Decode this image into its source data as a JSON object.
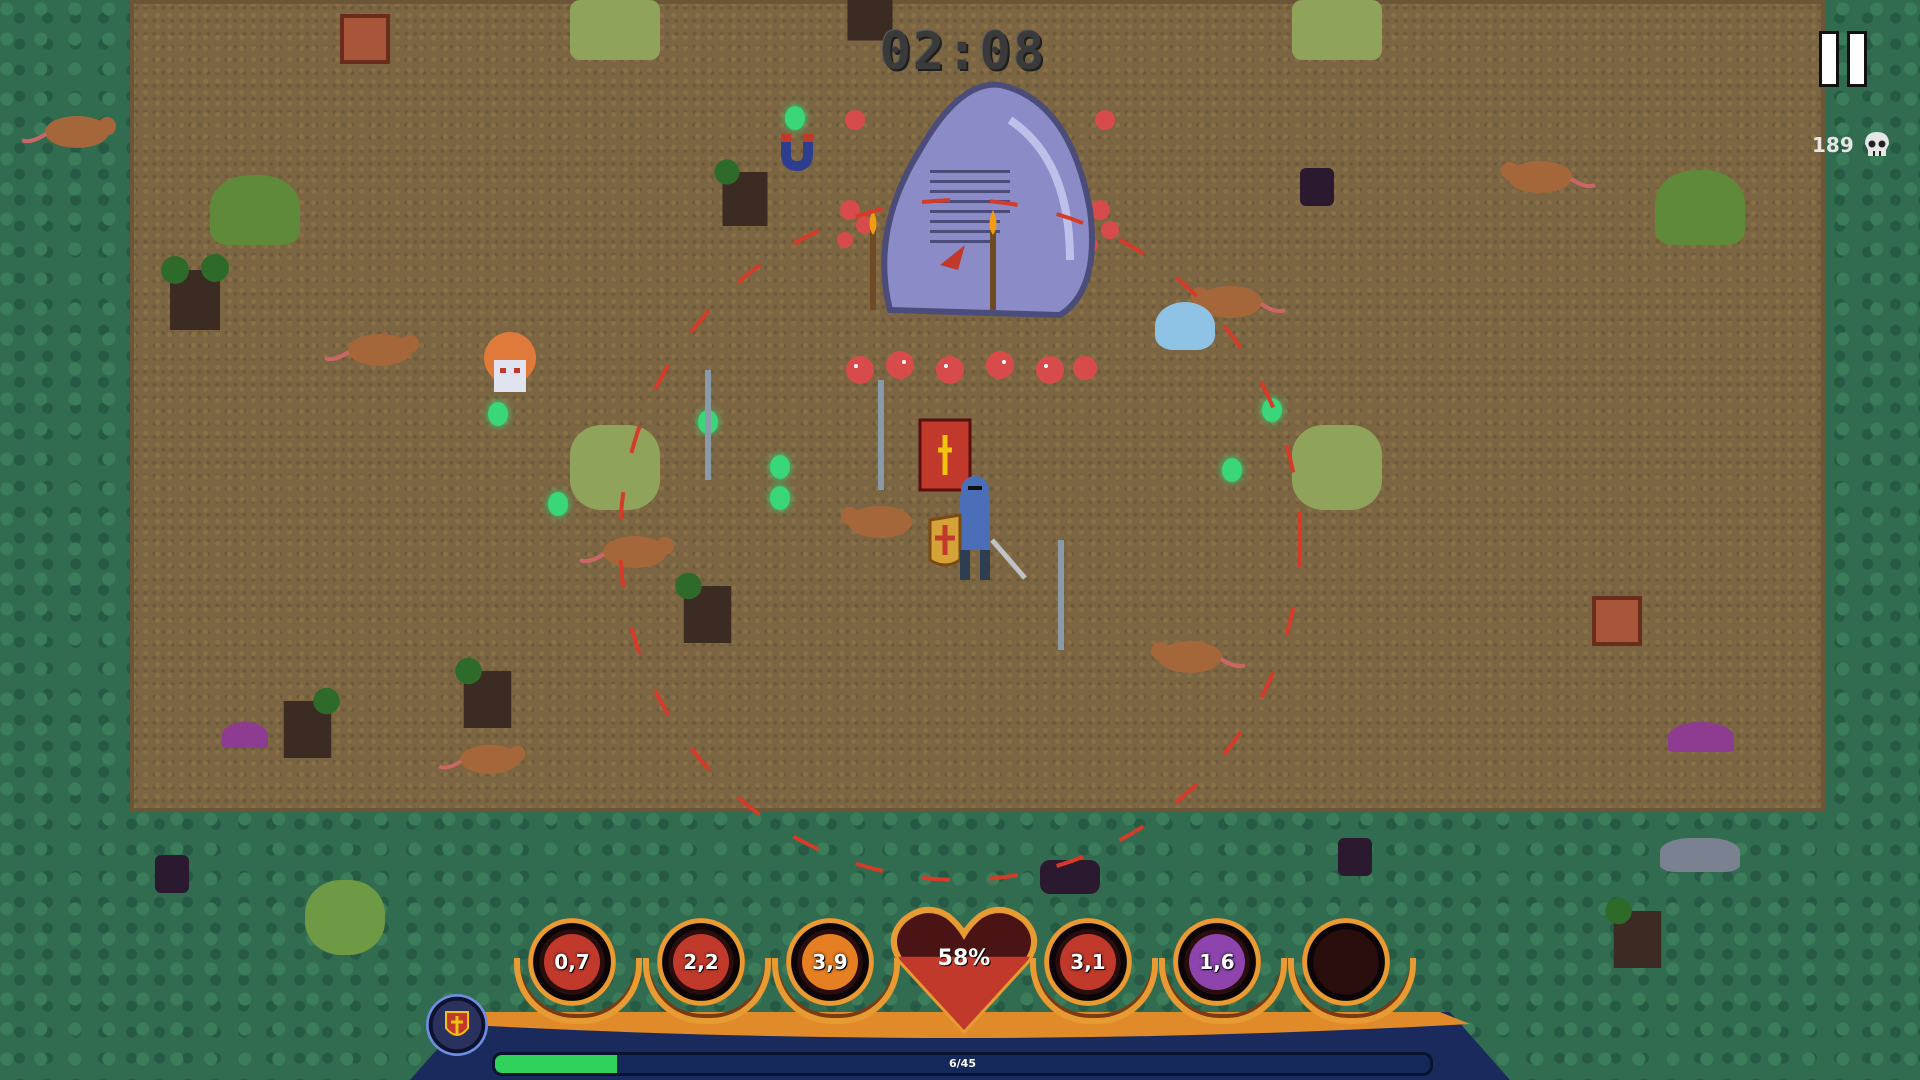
{
  "game": {
    "timer": "02:08",
    "kill_count": "189",
    "pause_icon": "pause-icon",
    "kills_icon": "skull-icon"
  },
  "hud": {
    "health_percent_label": "58%",
    "health_fraction": 0.58,
    "xp_label": "6/45",
    "xp_fraction": 0.13,
    "character_icon": "knight-shield-icon",
    "slots": [
      {
        "value": "0,7",
        "icon": "sword-icon",
        "color": "#c0392b"
      },
      {
        "value": "2,2",
        "icon": "shield-book-icon",
        "color": "#c0392b"
      },
      {
        "value": "3,9",
        "icon": "orange-orb-icon",
        "color": "#e67e22"
      },
      {
        "value": "3,1",
        "icon": "tornado-icon",
        "color": "#c0392b"
      },
      {
        "value": "1,6",
        "icon": "spell-tome-icon",
        "color": "#8e44ad"
      },
      {
        "value": "",
        "icon": "empty-slot-icon",
        "color": "#2a0d0d"
      }
    ]
  },
  "colors": {
    "grass": "#316c50",
    "arena": "#7b6542",
    "xp_fill": "#2fd35b",
    "heart": "#c0392b",
    "hud_gold": "#e89a33"
  }
}
